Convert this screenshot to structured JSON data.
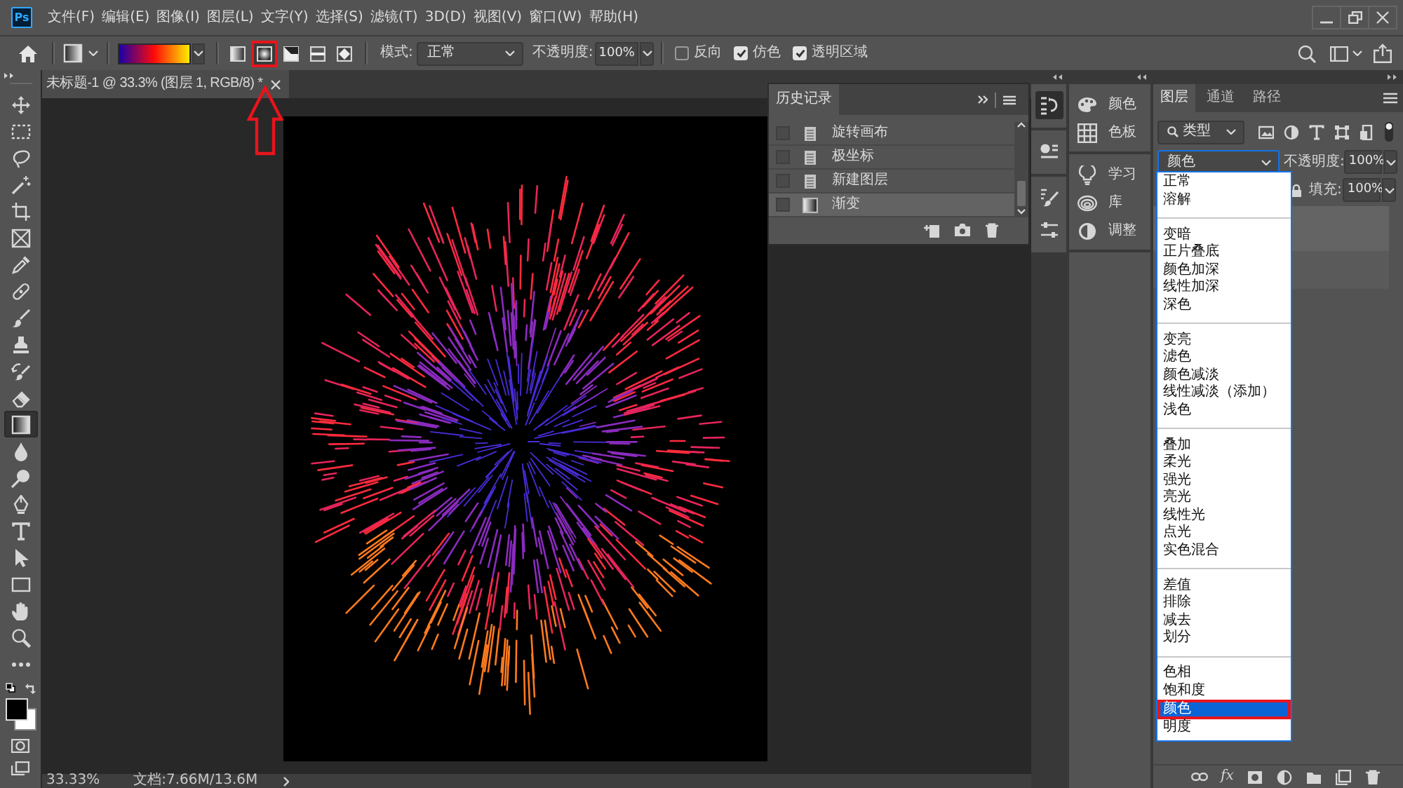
{
  "app": {
    "logo": "Ps"
  },
  "menu": [
    "文件(F)",
    "编辑(E)",
    "图像(I)",
    "图层(L)",
    "文字(Y)",
    "选择(S)",
    "滤镜(T)",
    "3D(D)",
    "视图(V)",
    "窗口(W)",
    "帮助(H)"
  ],
  "options_bar": {
    "gradient_types": [
      {
        "kind": "linear",
        "selected": false,
        "highlighted": false
      },
      {
        "kind": "radial",
        "selected": true,
        "highlighted": true
      },
      {
        "kind": "angle",
        "selected": false,
        "highlighted": false
      },
      {
        "kind": "reflected",
        "selected": false,
        "highlighted": false
      },
      {
        "kind": "diamond",
        "selected": false,
        "highlighted": false
      }
    ],
    "mode_label": "模式:",
    "mode_value": "正常",
    "opacity_label": "不透明度:",
    "opacity_value": "100%",
    "checkboxes": [
      {
        "label": "反向",
        "checked": false
      },
      {
        "label": "仿色",
        "checked": true
      },
      {
        "label": "透明区域",
        "checked": true
      }
    ]
  },
  "tools": [
    {
      "kind": "move",
      "selected": false
    },
    {
      "kind": "marquee",
      "selected": false
    },
    {
      "kind": "lasso",
      "selected": false
    },
    {
      "kind": "magic-wand",
      "selected": false
    },
    {
      "kind": "crop",
      "selected": false
    },
    {
      "kind": "frame",
      "selected": false
    },
    {
      "kind": "eyedropper",
      "selected": false
    },
    {
      "kind": "healing",
      "selected": false
    },
    {
      "kind": "brush",
      "selected": false
    },
    {
      "kind": "stamp",
      "selected": false
    },
    {
      "kind": "history-brush",
      "selected": false
    },
    {
      "kind": "eraser",
      "selected": false
    },
    {
      "kind": "gradient",
      "selected": true
    },
    {
      "kind": "blur",
      "selected": false
    },
    {
      "kind": "dodge",
      "selected": false
    },
    {
      "kind": "pen",
      "selected": false
    },
    {
      "kind": "type",
      "selected": false
    },
    {
      "kind": "path-select",
      "selected": false
    },
    {
      "kind": "rectangle",
      "selected": false
    },
    {
      "kind": "hand",
      "selected": false
    },
    {
      "kind": "zoom",
      "selected": false
    },
    {
      "kind": "more",
      "selected": false
    }
  ],
  "document": {
    "tab_title": "未标题-1 @ 33.3% (图层 1, RGB/8) *"
  },
  "history_panel": {
    "title": "历史记录",
    "states": [
      {
        "kind": "document",
        "label": "旋转画布",
        "selected": false
      },
      {
        "kind": "document",
        "label": "极坐标",
        "selected": false
      },
      {
        "kind": "document",
        "label": "新建图层",
        "selected": false
      },
      {
        "kind": "gradient",
        "label": "渐变",
        "selected": true
      }
    ]
  },
  "panel_strip": [
    [
      {
        "kind": "history",
        "selected": true
      }
    ],
    [
      {
        "kind": "properties",
        "selected": false
      }
    ],
    [
      {
        "kind": "brush-settings",
        "selected": false
      },
      {
        "kind": "adjustment-presets",
        "selected": false
      }
    ]
  ],
  "mini_panels": [
    [
      {
        "kind": "color",
        "label": "颜色"
      },
      {
        "kind": "swatches",
        "label": "色板"
      }
    ],
    [
      {
        "kind": "learn",
        "label": "学习"
      },
      {
        "kind": "libraries",
        "label": "库"
      },
      {
        "kind": "adjustments",
        "label": "调整"
      }
    ]
  ],
  "layers_panel": {
    "tabs": [
      {
        "label": "图层",
        "selected": true
      },
      {
        "label": "通道",
        "selected": false
      },
      {
        "label": "路径",
        "selected": false
      }
    ],
    "filter_value": "类型",
    "blend_mode": "颜色",
    "opacity_label": "不透明度:",
    "opacity_value": "100%",
    "fill_label": "填充:",
    "fill_value": "100%",
    "footer_fx": "fx",
    "blend_menu": [
      [
        {
          "label": "正常",
          "selected": false,
          "highlighted": false
        },
        {
          "label": "溶解",
          "selected": false,
          "highlighted": false
        }
      ],
      [
        {
          "label": "变暗",
          "selected": false,
          "highlighted": false
        },
        {
          "label": "正片叠底",
          "selected": false,
          "highlighted": false
        },
        {
          "label": "颜色加深",
          "selected": false,
          "highlighted": false
        },
        {
          "label": "线性加深",
          "selected": false,
          "highlighted": false
        },
        {
          "label": "深色",
          "selected": false,
          "highlighted": false
        }
      ],
      [
        {
          "label": "变亮",
          "selected": false,
          "highlighted": false
        },
        {
          "label": "滤色",
          "selected": false,
          "highlighted": false
        },
        {
          "label": "颜色减淡",
          "selected": false,
          "highlighted": false
        },
        {
          "label": "线性减淡（添加）",
          "selected": false,
          "highlighted": false
        },
        {
          "label": "浅色",
          "selected": false,
          "highlighted": false
        }
      ],
      [
        {
          "label": "叠加",
          "selected": false,
          "highlighted": false
        },
        {
          "label": "柔光",
          "selected": false,
          "highlighted": false
        },
        {
          "label": "强光",
          "selected": false,
          "highlighted": false
        },
        {
          "label": "亮光",
          "selected": false,
          "highlighted": false
        },
        {
          "label": "线性光",
          "selected": false,
          "highlighted": false
        },
        {
          "label": "点光",
          "selected": false,
          "highlighted": false
        },
        {
          "label": "实色混合",
          "selected": false,
          "highlighted": false
        }
      ],
      [
        {
          "label": "差值",
          "selected": false,
          "highlighted": false
        },
        {
          "label": "排除",
          "selected": false,
          "highlighted": false
        },
        {
          "label": "减去",
          "selected": false,
          "highlighted": false
        },
        {
          "label": "划分",
          "selected": false,
          "highlighted": false
        }
      ],
      [
        {
          "label": "色相",
          "selected": false,
          "highlighted": false
        },
        {
          "label": "饱和度",
          "selected": false,
          "highlighted": false
        },
        {
          "label": "颜色",
          "selected": true,
          "highlighted": true
        },
        {
          "label": "明度",
          "selected": false,
          "highlighted": false
        }
      ]
    ]
  },
  "status_bar": {
    "zoom": "33.33%",
    "doc_size": "文档:7.66M/13.6M"
  }
}
